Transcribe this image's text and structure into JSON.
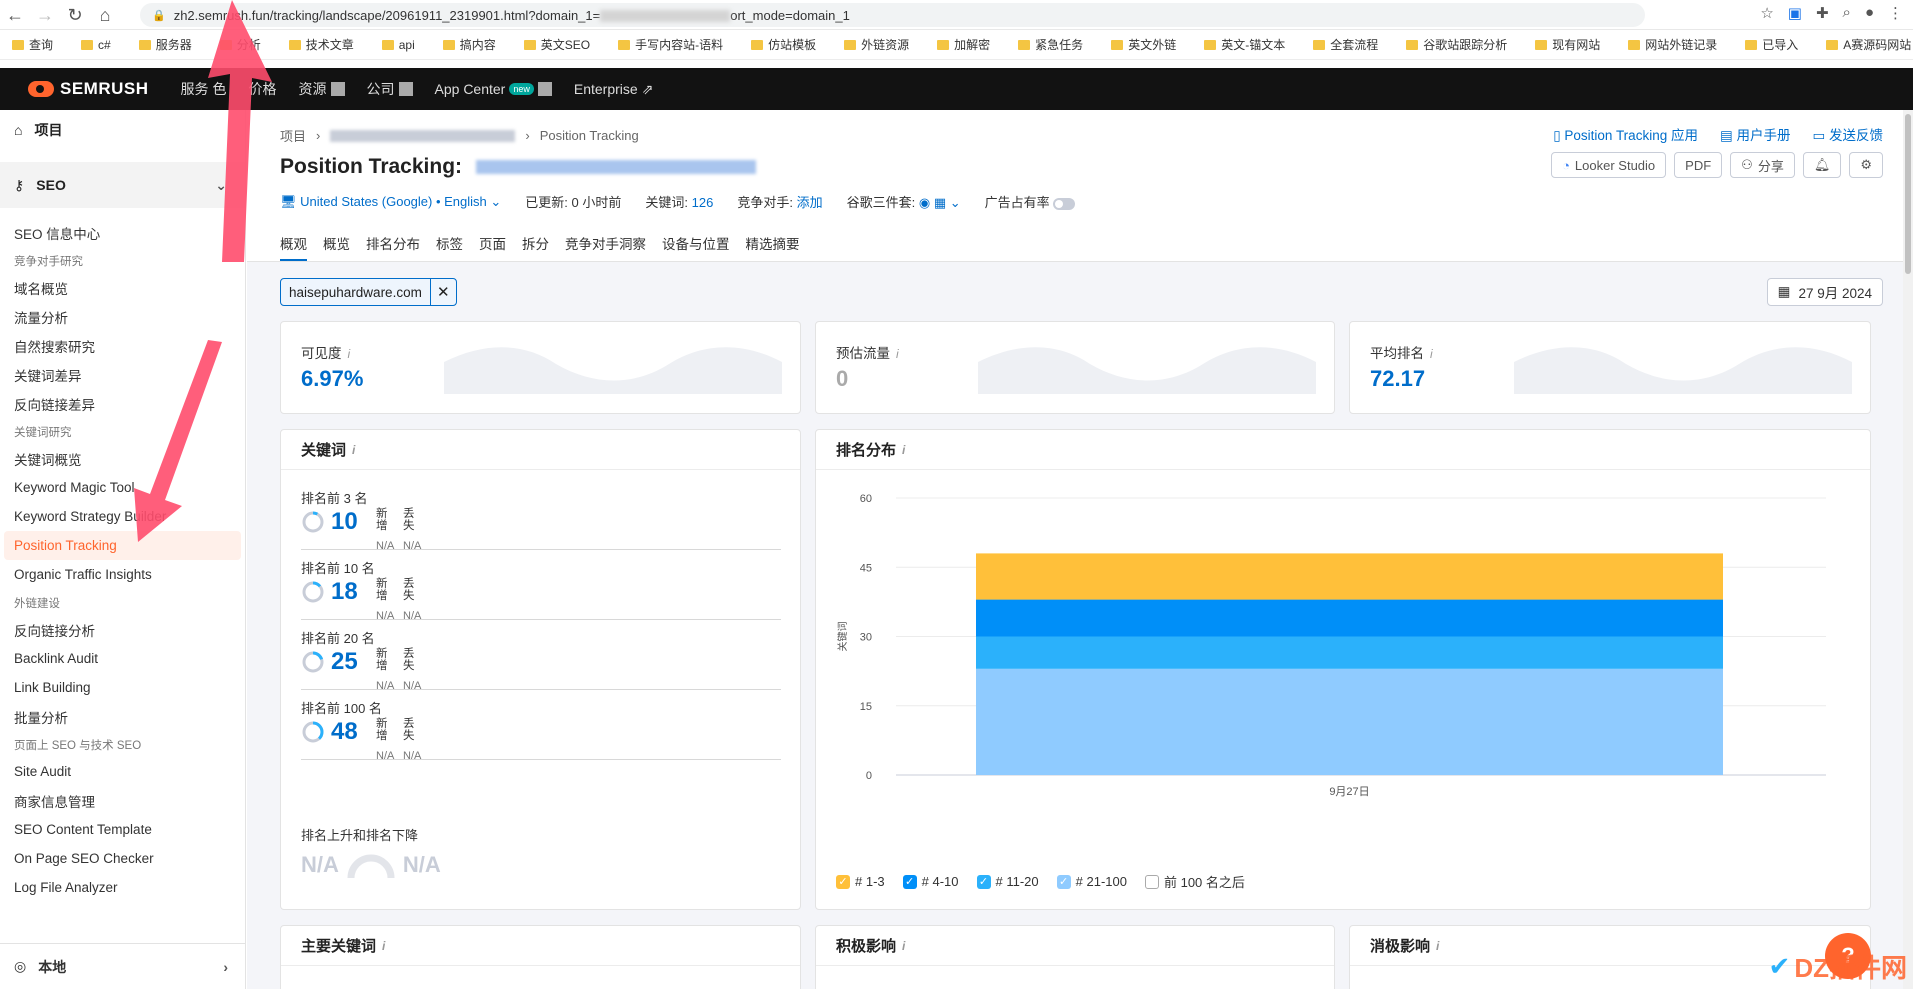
{
  "browser": {
    "url_prefix": "zh2.semrush.fun/tracking/landscape/20961911_2319901.html?domain_1=",
    "url_suffix": "ort_mode=domain_1",
    "bookmarks": [
      "查询",
      "c#",
      "服务器",
      "分析",
      "技术文章",
      "api",
      "搞内容",
      "英文SEO",
      "手写内容站-语料",
      "仿站模板",
      "外链资源",
      "加解密",
      "紧急任务",
      "英文外链",
      "英文-锚文本",
      "全套流程",
      "谷歌站跟踪分析",
      "现有网站",
      "网站外链记录",
      "已导入",
      "A赛源码网站"
    ]
  },
  "topnav": {
    "brand": "SEMRUSH",
    "items": [
      {
        "label": "服务",
        "extra": "色"
      },
      {
        "label": "价格"
      },
      {
        "label": "资源"
      },
      {
        "label": "公司"
      },
      {
        "label": "App Center",
        "badge": "new"
      },
      {
        "label": "Enterprise"
      }
    ]
  },
  "sidebar": {
    "projects": "项目",
    "seo": "SEO",
    "dashboard": "SEO 信息中心",
    "groups": [
      {
        "heading": "竞争对手研究",
        "items": [
          "域名概览",
          "流量分析",
          "自然搜索研究",
          "关键词差异",
          "反向链接差异"
        ]
      },
      {
        "heading": "关键词研究",
        "items": [
          "关键词概览",
          "Keyword Magic Tool",
          "Keyword Strategy Builder",
          "Position Tracking",
          "Organic Traffic Insights"
        ]
      },
      {
        "heading": "外链建设",
        "items": [
          "反向链接分析",
          "Backlink Audit",
          "Link Building",
          "批量分析"
        ]
      },
      {
        "heading": "页面上 SEO 与技术 SEO",
        "items": [
          "Site Audit",
          "商家信息管理",
          "SEO Content Template",
          "On Page SEO Checker",
          "Log File Analyzer"
        ]
      }
    ],
    "active_item": "Position Tracking",
    "local": "本地"
  },
  "header": {
    "breadcrumb_root": "项目",
    "breadcrumb_current": "Position Tracking",
    "title": "Position Tracking:",
    "top_links": [
      "Position Tracking 应用",
      "用户手册",
      "发送反馈"
    ],
    "actions": [
      "Looker Studio",
      "PDF",
      "分享"
    ],
    "location": "United States (Google) • English",
    "updated_label": "已更新:",
    "updated_value": "0 小时前",
    "keywords_label": "关键词:",
    "keywords_value": "126",
    "competitors_label": "竞争对手:",
    "competitors_value": "添加",
    "serp_label": "谷歌三件套:",
    "ads_label": "广告占有率",
    "tabs": [
      "概观",
      "概览",
      "排名分布",
      "标签",
      "页面",
      "拆分",
      "竞争对手洞察",
      "设备与位置",
      "精选摘要"
    ]
  },
  "filter": {
    "domain": "haisepuhardware.com",
    "date": "27 9月 2024"
  },
  "kpis": [
    {
      "label": "可见度",
      "value": "6.97%"
    },
    {
      "label": "预估流量",
      "value": "0"
    },
    {
      "label": "平均排名",
      "value": "72.17"
    }
  ],
  "keywords_card": {
    "title": "关键词",
    "rows": [
      {
        "label": "排名前 3 名",
        "value": "10",
        "fraction": 0.08
      },
      {
        "label": "排名前 10 名",
        "value": "18",
        "fraction": 0.14
      },
      {
        "label": "排名前 20 名",
        "value": "25",
        "fraction": 0.2
      },
      {
        "label": "排名前 100 名",
        "value": "48",
        "fraction": 0.38
      }
    ],
    "new_label": "新增",
    "lost_label": "丢失",
    "na": "N/A",
    "updown_label": "排名上升和排名下降",
    "updown_left": "N/A",
    "updown_right": "N/A"
  },
  "rank_card": {
    "title": "排名分布"
  },
  "chart_data": {
    "type": "bar",
    "stacked": true,
    "categories": [
      "9月27日"
    ],
    "ylabel": "关键词",
    "ylim": [
      0,
      60
    ],
    "yticks": [
      0,
      15,
      30,
      45,
      60
    ],
    "series": [
      {
        "name": "# 21-100",
        "values": [
          23
        ],
        "color": "#8fcbff"
      },
      {
        "name": "# 11-20",
        "values": [
          7
        ],
        "color": "#2bb1fb"
      },
      {
        "name": "# 4-10",
        "values": [
          8
        ],
        "color": "#008ff8"
      },
      {
        "name": "# 1-3",
        "values": [
          10
        ],
        "color": "#ffc03a"
      }
    ],
    "legend": [
      "# 1-3",
      "# 4-10",
      "# 11-20",
      "# 21-100",
      "前 100 名之后"
    ],
    "legend_placement": "bottom-left",
    "grid": true
  },
  "bottom_cards": [
    "主要关键词",
    "积极影响",
    "消极影响"
  ],
  "watermark": "DZ插件网"
}
